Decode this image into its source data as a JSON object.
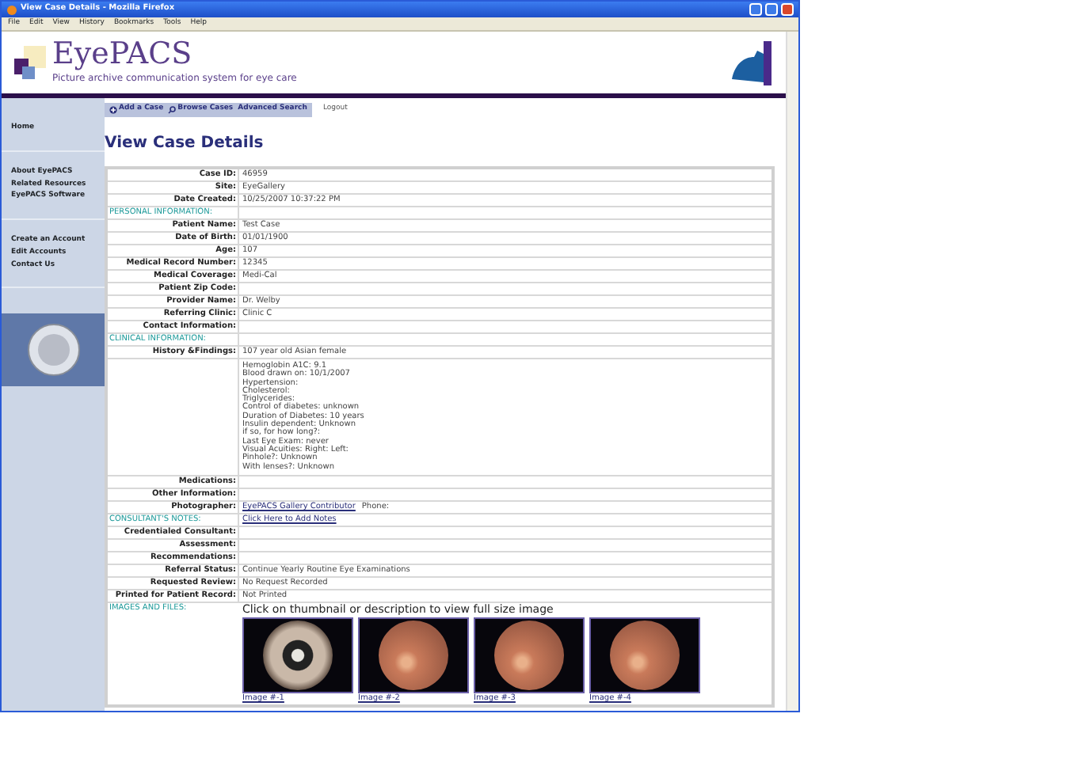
{
  "window": {
    "title": "View Case Details - Mozilla Firefox"
  },
  "menu": [
    "File",
    "Edit",
    "View",
    "History",
    "Bookmarks",
    "Tools",
    "Help"
  ],
  "header": {
    "logo": "EyePACS",
    "tagline": "Picture archive communication system for eye care"
  },
  "nav": {
    "buttons": [
      {
        "label": "Add a Case",
        "kind": "plus"
      },
      {
        "label": "Browse Cases",
        "kind": "search"
      },
      {
        "label": "Advanced Search",
        "kind": "none"
      }
    ],
    "logout": "Logout"
  },
  "sidebar": {
    "groups": [
      [
        "Home"
      ],
      [
        "About EyePACS",
        "Related Resources",
        "EyePACS Software"
      ],
      [
        "Create an Account",
        "Edit Accounts",
        "Contact Us"
      ]
    ]
  },
  "page_title": "View Case Details",
  "rows": [
    {
      "kind": "field",
      "label": "Case ID:",
      "value": "46959"
    },
    {
      "kind": "field",
      "label": "Site:",
      "value": "EyeGallery"
    },
    {
      "kind": "field",
      "label": "Date Created:",
      "value": "10/25/2007 10:37:22 PM"
    },
    {
      "kind": "section",
      "label": "PERSONAL INFORMATION:"
    },
    {
      "kind": "field",
      "label": "Patient Name:",
      "value": "Test Case"
    },
    {
      "kind": "field",
      "label": "Date of Birth:",
      "value": "01/01/1900"
    },
    {
      "kind": "field",
      "label": "Age:",
      "value": "107"
    },
    {
      "kind": "field",
      "label": "Medical Record Number:",
      "value": "12345"
    },
    {
      "kind": "field",
      "label": "Medical Coverage:",
      "value": "Medi-Cal"
    },
    {
      "kind": "field",
      "label": "Patient Zip Code:",
      "value": ""
    },
    {
      "kind": "field",
      "label": "Provider Name:",
      "value": "Dr. Welby"
    },
    {
      "kind": "field",
      "label": "Referring Clinic:",
      "value": "Clinic C"
    },
    {
      "kind": "field",
      "label": "Contact Information:",
      "value": ""
    },
    {
      "kind": "section",
      "label": "CLINICAL INFORMATION:"
    },
    {
      "kind": "field",
      "label": "History &Findings:",
      "value": "107 year old Asian female"
    },
    {
      "kind": "notes",
      "lines": [
        "Hemoglobin A1C: 9.1",
        "Blood drawn on: 10/1/2007",
        "Hypertension:",
        "Cholesterol:",
        "Triglycerides:",
        "Control of diabetes: unknown",
        "Duration of Diabetes: 10 years",
        "Insulin dependent: Unknown",
        "if so, for how long?:",
        "Last Eye Exam: never",
        "Visual Acuities: Right: Left:",
        "Pinhole?: Unknown",
        "With lenses?: Unknown"
      ]
    },
    {
      "kind": "field",
      "label": "Medications:",
      "value": ""
    },
    {
      "kind": "field",
      "label": "Other Information:",
      "value": ""
    },
    {
      "kind": "link",
      "label": "Photographer:",
      "link": "EyePACS Gallery Contributor",
      "value": "Phone:"
    },
    {
      "kind": "section",
      "label": "CONSULTANT'S NOTES:",
      "link": "Click Here to Add Notes"
    },
    {
      "kind": "field",
      "label": "Credentialed Consultant:",
      "value": ""
    },
    {
      "kind": "field",
      "label": "Assessment:",
      "value": ""
    },
    {
      "kind": "field",
      "label": "Recommendations:",
      "value": ""
    },
    {
      "kind": "field",
      "label": "Referral Status:",
      "value": "Continue Yearly Routine Eye Examinations"
    },
    {
      "kind": "field",
      "label": "Requested Review:",
      "value": "No Request Recorded"
    },
    {
      "kind": "field",
      "label": "Printed for Patient Record:",
      "value": "Not Printed"
    },
    {
      "kind": "images",
      "label": "IMAGES AND FILES:",
      "caption": "Click on thumbnail or description to view full size image",
      "thumbnails": [
        {
          "label": "Image #-1",
          "kind": "external"
        },
        {
          "label": "Image #-2",
          "kind": "fundus"
        },
        {
          "label": "Image #-3",
          "kind": "fundus"
        },
        {
          "label": "Image #-4",
          "kind": "fundus"
        }
      ]
    }
  ]
}
